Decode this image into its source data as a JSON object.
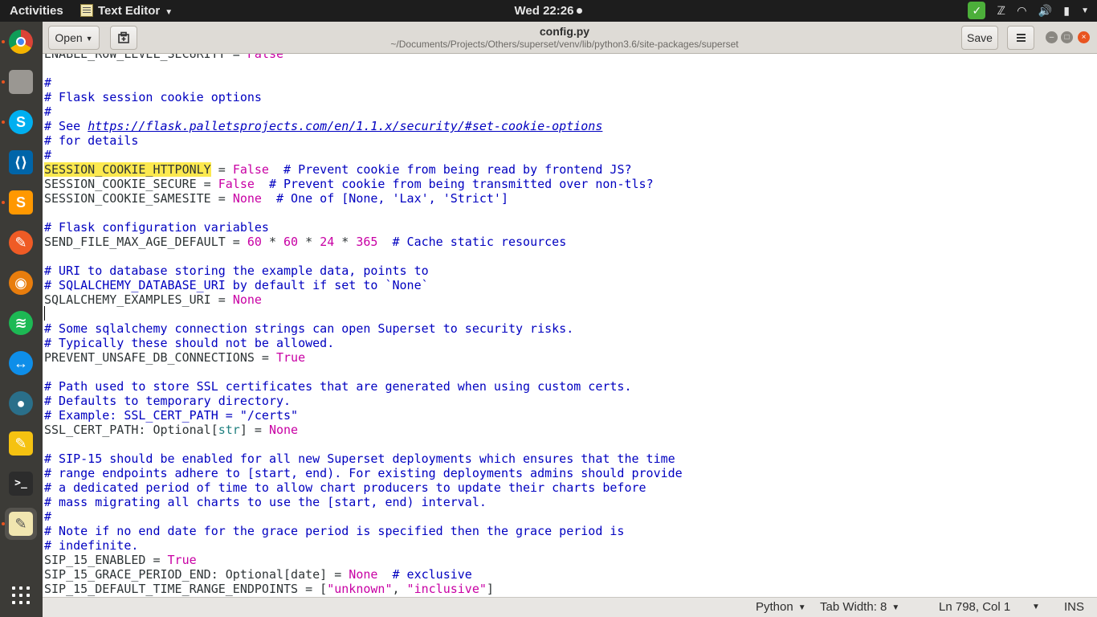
{
  "topbar": {
    "activities": "Activities",
    "app_menu": "Text Editor",
    "clock": "Wed 22:26"
  },
  "dock": {
    "items": [
      {
        "name": "chrome",
        "glyph": "",
        "color": "#dd4b39"
      },
      {
        "name": "file-manager",
        "glyph": "",
        "color": "#9a9792"
      },
      {
        "name": "skype",
        "glyph": "S",
        "color": "#00aff0"
      },
      {
        "name": "vscode",
        "glyph": "⟨⟩",
        "color": "#0065a9"
      },
      {
        "name": "sublime-text",
        "glyph": "S",
        "color": "#ff9800"
      },
      {
        "name": "postman",
        "glyph": "✎",
        "color": "#ef5b25"
      },
      {
        "name": "blender",
        "glyph": "◉",
        "color": "#e87d0d"
      },
      {
        "name": "spotify",
        "glyph": "≋",
        "color": "#1db954"
      },
      {
        "name": "teamviewer",
        "glyph": "↔",
        "color": "#0e8ee9"
      },
      {
        "name": "camera",
        "glyph": "●",
        "color": "#2a6f8a"
      },
      {
        "name": "notes",
        "glyph": "✎",
        "color": "#f5c211"
      },
      {
        "name": "terminal",
        "glyph": ">_",
        "color": "#2c2c2c"
      },
      {
        "name": "text-editor",
        "glyph": "✎",
        "color": "#f1e6b0"
      }
    ]
  },
  "header": {
    "open_label": "Open",
    "title": "config.py",
    "path": "~/Documents/Projects/Others/superset/venv/lib/python3.6/site-packages/superset",
    "save_label": "Save"
  },
  "editor": {
    "lines": [
      {
        "text": "ENABLE_ROW_LEVEL_SECURITY = False"
      },
      {
        "text": ""
      },
      {
        "text": "#"
      },
      {
        "text": "# Flask session cookie options"
      },
      {
        "text": "#"
      },
      {
        "text": "# See https://flask.palletsprojects.com/en/1.1.x/security/#set-cookie-options"
      },
      {
        "text": "# for details"
      },
      {
        "text": "#"
      },
      {
        "text": "SESSION_COOKIE_HTTPONLY = False  # Prevent cookie from being read by frontend JS?"
      },
      {
        "text": "SESSION_COOKIE_SECURE = False  # Prevent cookie from being transmitted over non-tls?"
      },
      {
        "text": "SESSION_COOKIE_SAMESITE = None  # One of [None, 'Lax', 'Strict']"
      },
      {
        "text": ""
      },
      {
        "text": "# Flask configuration variables"
      },
      {
        "text": "SEND_FILE_MAX_AGE_DEFAULT = 60 * 60 * 24 * 365  # Cache static resources"
      },
      {
        "text": ""
      },
      {
        "text": "# URI to database storing the example data, points to"
      },
      {
        "text": "# SQLALCHEMY_DATABASE_URI by default if set to `None`"
      },
      {
        "text": "SQLALCHEMY_EXAMPLES_URI = None"
      },
      {
        "text": ""
      },
      {
        "text": "# Some sqlalchemy connection strings can open Superset to security risks."
      },
      {
        "text": "# Typically these should not be allowed."
      },
      {
        "text": "PREVENT_UNSAFE_DB_CONNECTIONS = True"
      },
      {
        "text": ""
      },
      {
        "text": "# Path used to store SSL certificates that are generated when using custom certs."
      },
      {
        "text": "# Defaults to temporary directory."
      },
      {
        "text": "# Example: SSL_CERT_PATH = \"/certs\""
      },
      {
        "text": "SSL_CERT_PATH: Optional[str] = None"
      },
      {
        "text": ""
      },
      {
        "text": "# SIP-15 should be enabled for all new Superset deployments which ensures that the time"
      },
      {
        "text": "# range endpoints adhere to [start, end). For existing deployments admins should provide"
      },
      {
        "text": "# a dedicated period of time to allow chart producers to update their charts before"
      },
      {
        "text": "# mass migrating all charts to use the [start, end) interval."
      },
      {
        "text": "#"
      },
      {
        "text": "# Note if no end date for the grace period is specified then the grace period is"
      },
      {
        "text": "# indefinite."
      },
      {
        "text": "SIP_15_ENABLED = True"
      },
      {
        "text": "SIP_15_GRACE_PERIOD_END: Optional[date] = None  # exclusive"
      },
      {
        "text": "SIP_15_DEFAULT_TIME_RANGE_ENDPOINTS = [\"unknown\", \"inclusive\"]"
      }
    ]
  },
  "statusbar": {
    "language": "Python",
    "tab_width": "Tab Width: 8",
    "position": "Ln 798, Col 1",
    "mode": "INS"
  }
}
